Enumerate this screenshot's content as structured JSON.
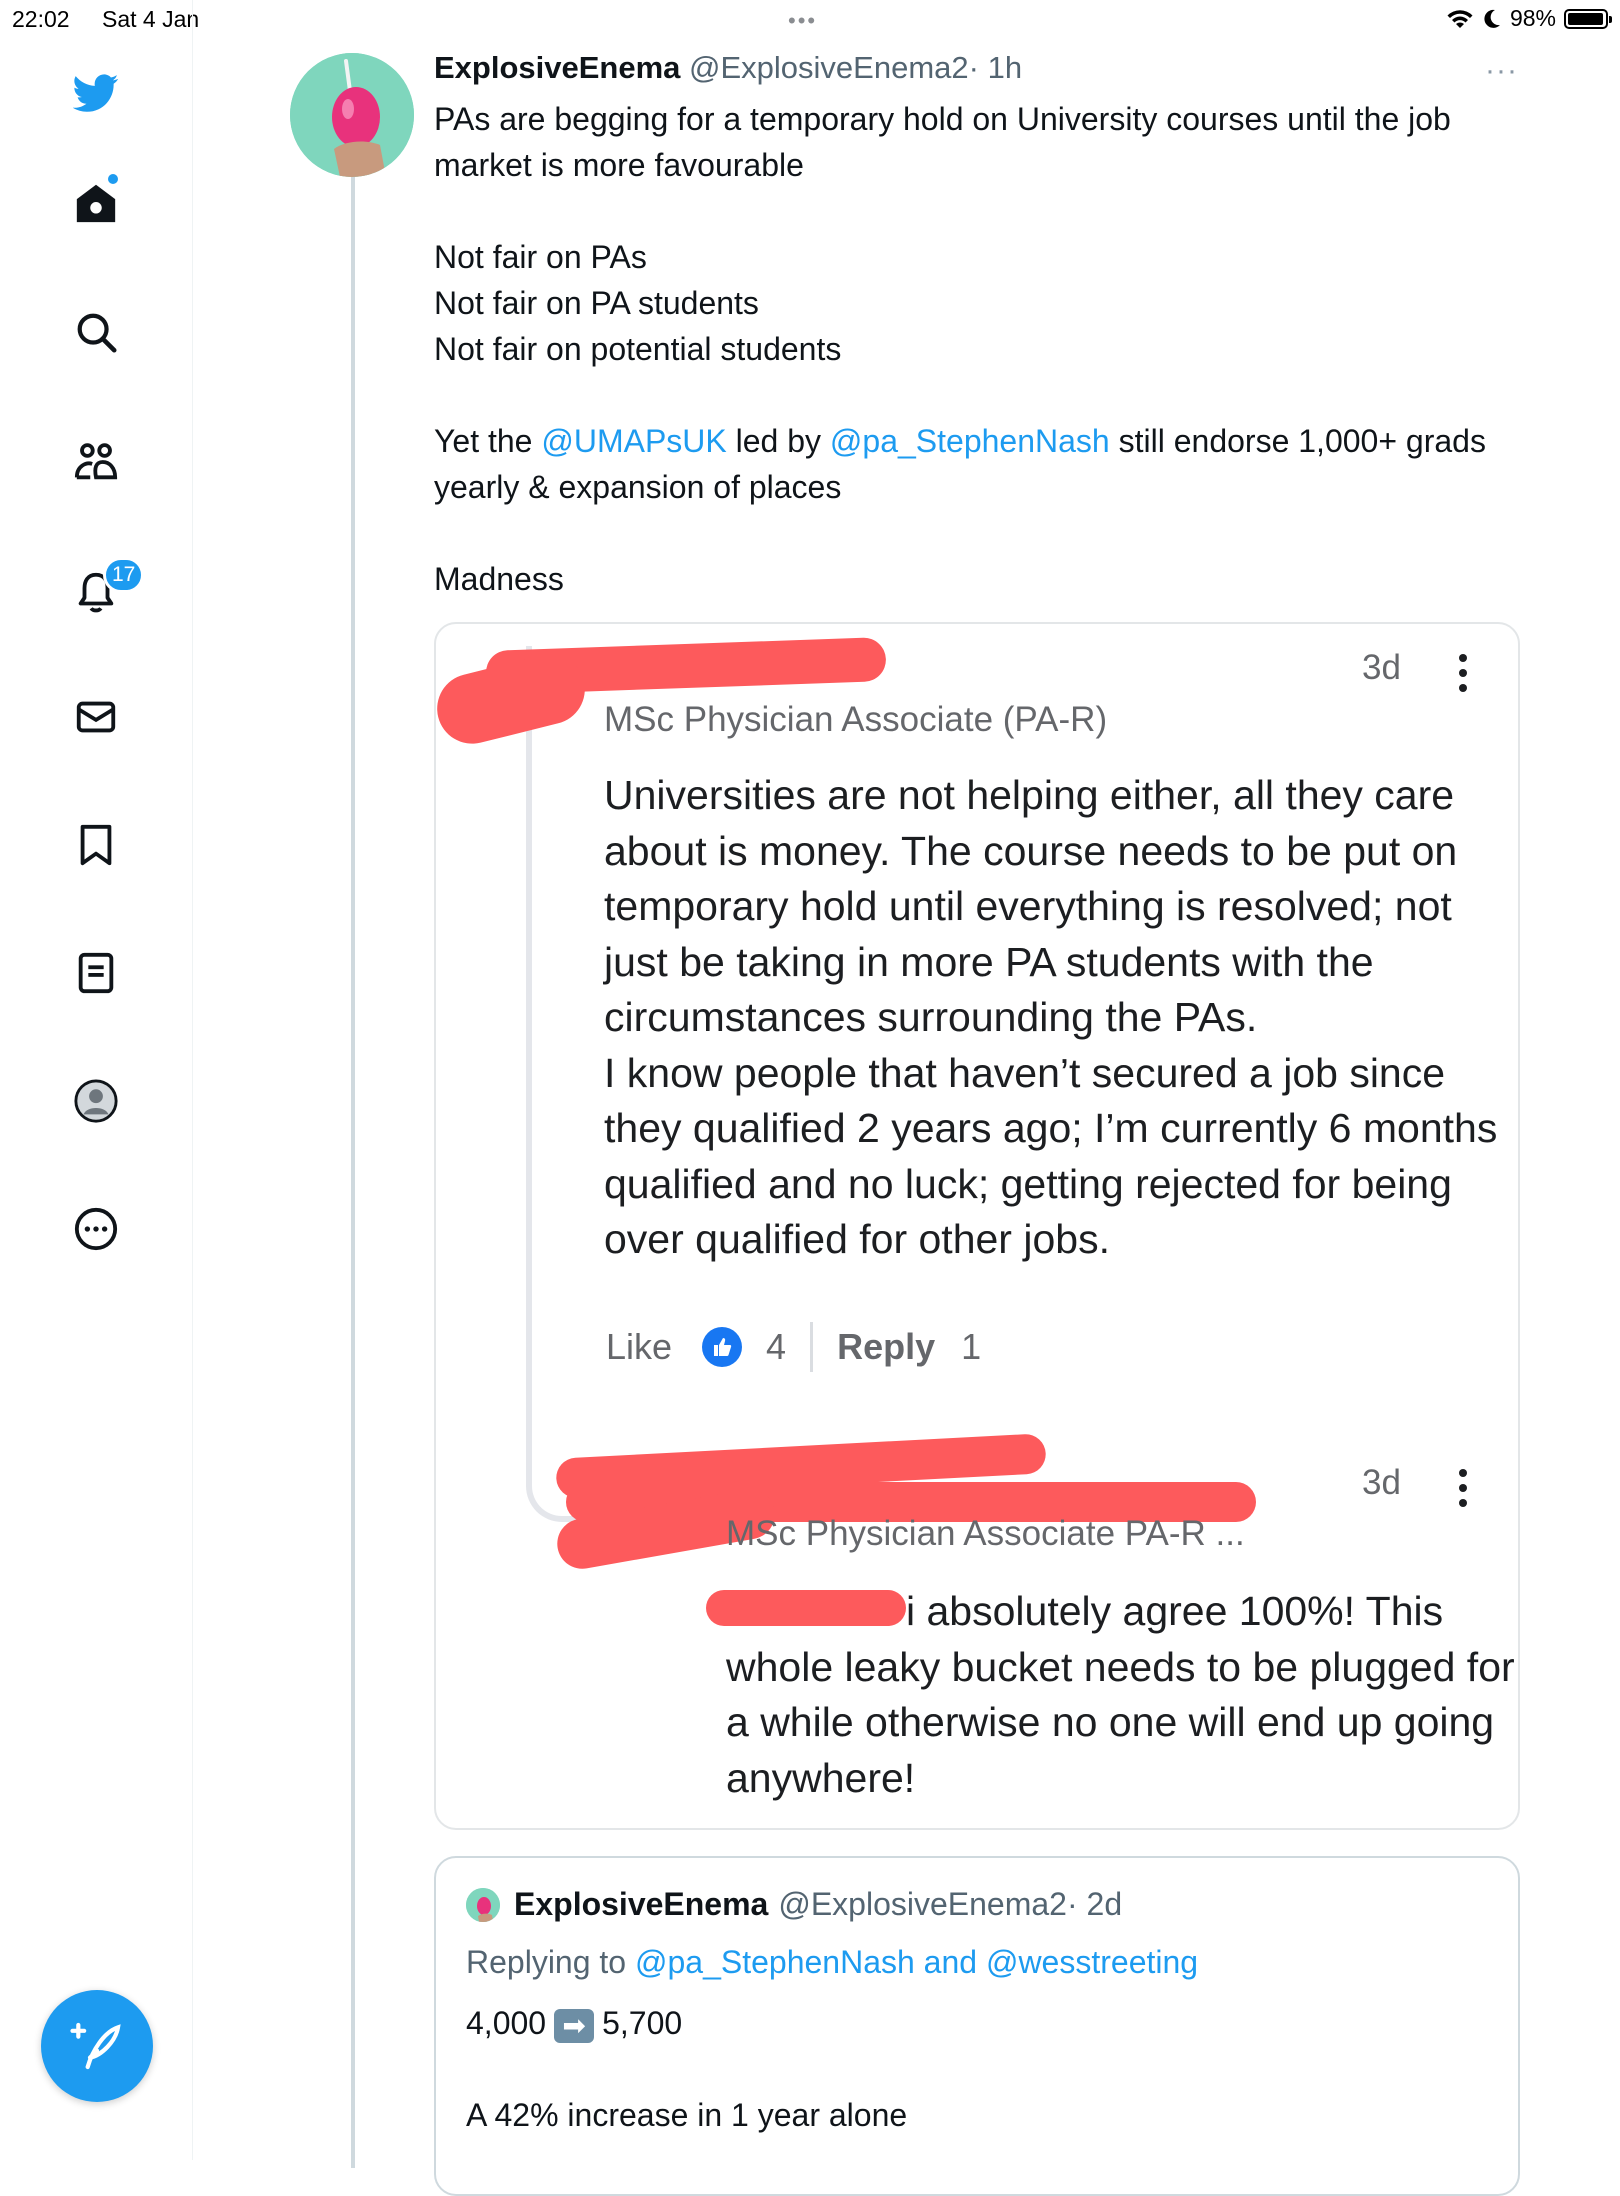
{
  "status_bar": {
    "time": "22:02",
    "date": "Sat 4 Jan",
    "dots": "•••",
    "battery": "98%",
    "battery_level": 0.98
  },
  "nav": {
    "icons": [
      "twitter-bird-icon",
      "home-icon",
      "search-icon",
      "communities-icon",
      "notifications-icon",
      "messages-icon",
      "bookmarks-icon",
      "lists-icon",
      "profile-icon",
      "more-icon"
    ],
    "notification_count": "17",
    "accent_color": "#1d9bf0"
  },
  "tweet": {
    "author_name": "ExplosiveEnema",
    "handle": "@ExplosiveEnema2",
    "time": "· 1h",
    "more": "···",
    "line1": "PAs are begging for a temporary hold on University courses until the job market is more favourable",
    "line2": "Not fair on PAs",
    "line3": "Not fair on PA students",
    "line4": "Not fair on potential students",
    "line5_prefix": "Yet the ",
    "line5_mention1": "@UMAPsUK",
    "line5_mid": " led by ",
    "line5_mention2": "@pa_StephenNash",
    "line5_suffix": " still endorse 1,000+ grads yearly & expansion of places",
    "line6": "Madness"
  },
  "image": {
    "comment1": {
      "time": "3d",
      "subtitle": "MSc Physician Associate (PA-R)",
      "body1": "Universities are not helping either, all they care about is money. The course needs to be put on temporary hold until everything is resolved; not just be taking in more PA students with the circumstances surrounding the PAs.",
      "body2": "I know people that haven’t secured a job since they qualified 2 years ago; I’m currently 6 months qualified and no luck; getting rejected for being over qualified for other jobs.",
      "like_label": "Like",
      "like_count": "4",
      "reply_label": "Reply",
      "reply_count": "1"
    },
    "comment2": {
      "time": "3d",
      "subtitle": "MSc Physician Associate PA-R ...",
      "body": "i absolutely agree 100%! This whole leaky bucket needs to be plugged for a while otherwise no one will end up going anywhere!"
    }
  },
  "quote": {
    "author_name": "ExplosiveEnema",
    "handle": "@ExplosiveEnema2",
    "time": "· 2d",
    "replying_prefix": "Replying to ",
    "replying_mentions": "@pa_StephenNash and @wesstreeting",
    "stat_from": "4,000",
    "stat_arrow": "➡",
    "stat_to": "5,700",
    "line2": "A 42% increase in 1 year alone"
  }
}
